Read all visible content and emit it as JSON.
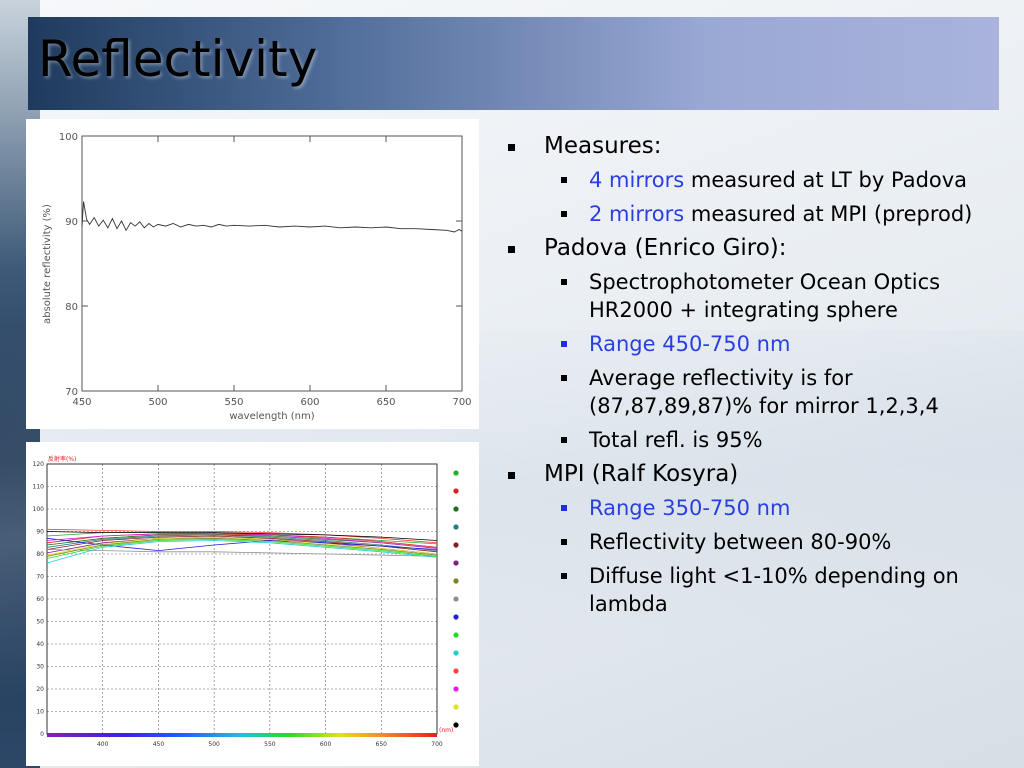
{
  "title": "Reflectivity",
  "colors": {
    "highlight": "#2a3fe0",
    "title_bar_dark": "#1e3a5c",
    "title_bar_light": "#a9b3dc"
  },
  "bullets": {
    "b1": {
      "label": "Measures:"
    },
    "b1a": {
      "highlight": "4 mirrors",
      "rest": " measured at LT by Padova"
    },
    "b1b": {
      "highlight": "2 mirrors",
      "rest": " measured at MPI (preprod)"
    },
    "b2": {
      "label": "Padova (Enrico Giro):"
    },
    "b2a": {
      "text": "Spectrophotometer Ocean Optics HR2000 + integrating sphere"
    },
    "b2b": {
      "text": "Range 450-750 nm"
    },
    "b2c": {
      "text": "Average reflectivity is for (87,87,89,87)% for mirror 1,2,3,4"
    },
    "b2d": {
      "text": "Total refl. is 95%"
    },
    "b3": {
      "label": "MPI (Ralf Kosyra)"
    },
    "b3a": {
      "text": "Range 350-750 nm"
    },
    "b3b": {
      "text": "Reflectivity between 80-90%"
    },
    "b3c": {
      "text": "Diffuse light <1-10% depending on lambda"
    }
  },
  "chart_data": [
    {
      "type": "line",
      "xlabel": "wavelength (nm)",
      "ylabel": "absolute reflectivity (%)",
      "xlim": [
        450,
        700
      ],
      "ylim": [
        70,
        100
      ],
      "xticks": [
        450,
        500,
        550,
        600,
        650,
        700
      ],
      "yticks": [
        70,
        80,
        90,
        100
      ],
      "grid": false,
      "series": [
        {
          "x": [
            450,
            451,
            453,
            455,
            458,
            461,
            464,
            467,
            470,
            473,
            476,
            479,
            482,
            485,
            488,
            491,
            494,
            497,
            500,
            505,
            510,
            515,
            520,
            525,
            530,
            535,
            540,
            545,
            550,
            560,
            570,
            580,
            590,
            600,
            610,
            620,
            630,
            640,
            650,
            660,
            670,
            680,
            690,
            695,
            698,
            700
          ],
          "y": [
            89.3,
            92.3,
            90.2,
            89.6,
            90.4,
            89.4,
            90.1,
            89.2,
            90.3,
            89.1,
            90.0,
            88.9,
            89.8,
            89.4,
            89.9,
            89.2,
            89.7,
            89.3,
            89.6,
            89.4,
            89.7,
            89.3,
            89.6,
            89.4,
            89.5,
            89.3,
            89.6,
            89.4,
            89.5,
            89.4,
            89.5,
            89.3,
            89.4,
            89.3,
            89.4,
            89.2,
            89.3,
            89.2,
            89.3,
            89.1,
            89.1,
            89.0,
            88.9,
            88.7,
            89.0,
            88.8
          ]
        }
      ]
    },
    {
      "type": "line",
      "ylabel": "反射率(%)",
      "xunit": "(nm)",
      "xlim": [
        350,
        700
      ],
      "ylim": [
        0,
        120
      ],
      "xticks": [
        400,
        450,
        500,
        550,
        600,
        650,
        700
      ],
      "yticks": [
        0,
        10,
        20,
        30,
        40,
        50,
        60,
        70,
        80,
        90,
        100,
        110,
        120
      ],
      "grid": true,
      "legend": "right",
      "series": [
        {
          "color": "#20b020",
          "x": [
            350,
            400,
            450,
            500,
            550,
            600,
            650,
            700
          ],
          "y": [
            88,
            89.5,
            89.5,
            89,
            88.5,
            87.5,
            86,
            84.5
          ]
        },
        {
          "color": "#e02020",
          "x": [
            350,
            400,
            450,
            500,
            550,
            600,
            650,
            700
          ],
          "y": [
            85,
            88,
            89,
            89,
            88.5,
            87.5,
            85.5,
            83
          ]
        },
        {
          "color": "#207020",
          "x": [
            350,
            400,
            450,
            500,
            550,
            600,
            650,
            700
          ],
          "y": [
            84,
            87,
            88.5,
            88.5,
            88,
            86.5,
            85,
            82.5
          ]
        },
        {
          "color": "#208080",
          "x": [
            350,
            400,
            450,
            500,
            550,
            600,
            650,
            700
          ],
          "y": [
            83,
            86.5,
            88,
            88.5,
            87.5,
            86,
            84,
            81.5
          ]
        },
        {
          "color": "#802020",
          "x": [
            350,
            400,
            450,
            500,
            550,
            600,
            650,
            700
          ],
          "y": [
            82,
            86,
            87.5,
            88,
            87,
            85.5,
            83.5,
            81
          ]
        },
        {
          "color": "#802080",
          "x": [
            350,
            400,
            450,
            500,
            550,
            600,
            650,
            700
          ],
          "y": [
            80.5,
            85,
            87,
            87.5,
            86.5,
            85,
            82.5,
            80
          ]
        },
        {
          "color": "#808020",
          "x": [
            350,
            400,
            450,
            500,
            550,
            600,
            650,
            700
          ],
          "y": [
            79,
            84,
            86.5,
            87,
            86,
            84,
            82,
            79.5
          ]
        },
        {
          "color": "#909090",
          "x": [
            350,
            400,
            450,
            500,
            550,
            600,
            650,
            700
          ],
          "y": [
            82,
            81.5,
            81,
            81,
            80.5,
            80,
            79.5,
            79
          ]
        },
        {
          "color": "#2020e0",
          "x": [
            350,
            400,
            450,
            500,
            550,
            600,
            650,
            700
          ],
          "y": [
            87,
            84,
            81.5,
            84,
            86,
            85,
            83.5,
            82
          ]
        },
        {
          "color": "#20e020",
          "x": [
            350,
            400,
            450,
            500,
            550,
            600,
            650,
            700
          ],
          "y": [
            78,
            83.5,
            86,
            86.5,
            85.5,
            83.5,
            81.5,
            79
          ]
        },
        {
          "color": "#20d0d0",
          "x": [
            350,
            400,
            450,
            500,
            550,
            600,
            650,
            700
          ],
          "y": [
            76,
            83,
            85.5,
            86,
            85,
            83,
            81,
            78.5
          ]
        },
        {
          "color": "#ff4040",
          "x": [
            350,
            400,
            450,
            500,
            550,
            600,
            650,
            700
          ],
          "y": [
            91,
            90.5,
            90,
            90,
            89.5,
            88.5,
            87,
            85
          ]
        },
        {
          "color": "#e020e0",
          "x": [
            350,
            400,
            450,
            500,
            550,
            600,
            650,
            700
          ],
          "y": [
            86,
            88,
            89,
            89.5,
            88.5,
            87,
            85,
            82.5
          ]
        },
        {
          "color": "#e0e020",
          "x": [
            350,
            400,
            450,
            500,
            550,
            600,
            650,
            700
          ],
          "y": [
            79.5,
            84.5,
            87,
            87.5,
            86.5,
            84.5,
            82.5,
            80
          ]
        },
        {
          "color": "#000000",
          "x": [
            350,
            400,
            450,
            500,
            550,
            600,
            650,
            700
          ],
          "y": [
            90,
            89.5,
            89.5,
            89.5,
            89,
            88.5,
            87.5,
            86
          ]
        }
      ]
    }
  ]
}
